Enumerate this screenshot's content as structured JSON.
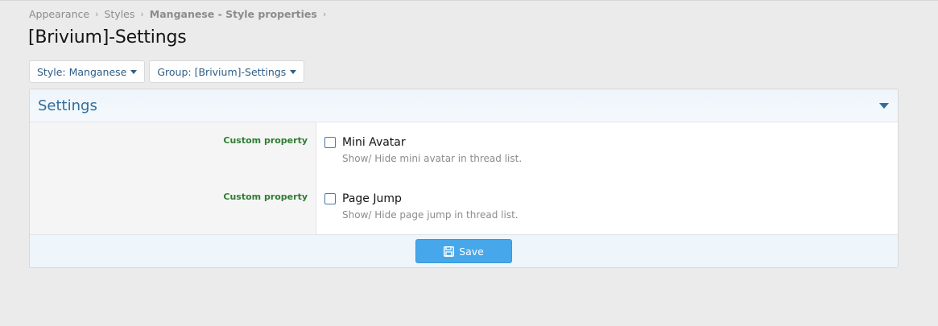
{
  "breadcrumb": {
    "items": [
      "Appearance",
      "Styles",
      "Manganese - Style properties"
    ],
    "separator": "›"
  },
  "page": {
    "title": "[Brivium]-Settings"
  },
  "filters": {
    "style_label": "Style: Manganese",
    "group_label": "Group: [Brivium]-Settings"
  },
  "section": {
    "title": "Settings",
    "rows": [
      {
        "label": "Custom property",
        "checkbox_label": "Mini Avatar",
        "checked": false,
        "hint": "Show/ Hide mini avatar in thread list."
      },
      {
        "label": "Custom property",
        "checkbox_label": "Page Jump",
        "checked": false,
        "hint": "Show/ Hide page jump in thread list."
      }
    ]
  },
  "footer": {
    "save_label": "Save"
  },
  "icons": {
    "save": "floppy-disk-icon",
    "menu_caret": "caret-down-icon",
    "collapse": "collapse-toggle-icon"
  },
  "colors": {
    "accent": "#2f6d9e",
    "button": "#47a7eb",
    "property_label": "#2e7d32"
  }
}
